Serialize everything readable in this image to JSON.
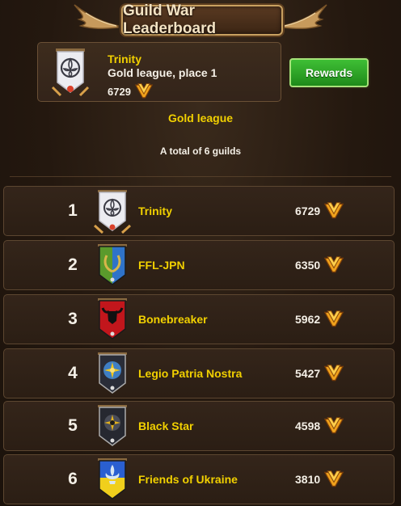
{
  "header": {
    "title": "Guild War Leaderboard"
  },
  "my_guild": {
    "name": "Trinity",
    "league_place": "Gold league, place 1",
    "score": "6729"
  },
  "buttons": {
    "rewards": "Rewards"
  },
  "league": {
    "name": "Gold league",
    "total": "A total of 6 guilds"
  },
  "rows": [
    {
      "rank": "1",
      "name": "Trinity",
      "score": "6729",
      "banner_icon": "triquetra-banner-icon",
      "colors": [
        "#e9e9ee",
        "#c7c7cf"
      ]
    },
    {
      "rank": "2",
      "name": "FFL-JPN",
      "score": "6350",
      "banner_icon": "laurel-wreath-banner-icon",
      "colors": [
        "#2f73c9",
        "#5a9a2c"
      ]
    },
    {
      "rank": "3",
      "name": "Bonebreaker",
      "score": "5962",
      "banner_icon": "bull-skull-banner-icon",
      "colors": [
        "#c2161c",
        "#8c0c10"
      ]
    },
    {
      "rank": "4",
      "name": "Legio Patria Nostra",
      "score": "5427",
      "banner_icon": "sun-emblem-banner-icon",
      "colors": [
        "#2a2d38",
        "#3a3f4e"
      ]
    },
    {
      "rank": "5",
      "name": "Black Star",
      "score": "4598",
      "banner_icon": "star-emblem-banner-icon",
      "colors": [
        "#262830",
        "#33363f"
      ]
    },
    {
      "rank": "6",
      "name": "Friends of Ukraine",
      "score": "3810",
      "banner_icon": "fleur-de-lis-banner-icon",
      "colors": [
        "#2a5fd1",
        "#f0cf1c"
      ]
    }
  ]
}
